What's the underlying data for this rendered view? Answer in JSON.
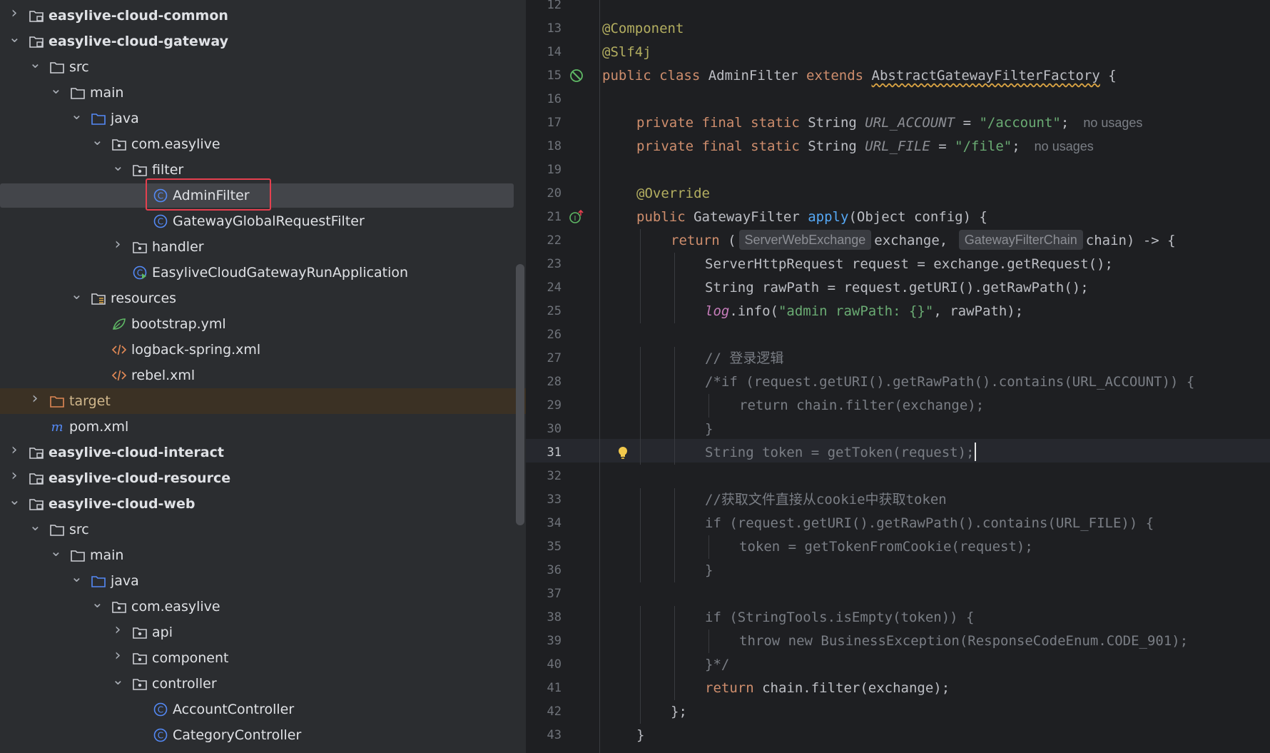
{
  "tree": {
    "rows": [
      {
        "label": "easylive-cloud-common",
        "bold": true,
        "chevron": "right",
        "icon": "module-folder-icon",
        "depth": 0
      },
      {
        "label": "easylive-cloud-gateway",
        "bold": true,
        "chevron": "down",
        "icon": "module-folder-icon",
        "depth": 0
      },
      {
        "label": "src",
        "chevron": "down",
        "icon": "folder-icon",
        "depth": 1
      },
      {
        "label": "main",
        "chevron": "down",
        "icon": "folder-icon",
        "depth": 2
      },
      {
        "label": "java",
        "chevron": "down",
        "icon": "source-folder-icon",
        "depth": 3
      },
      {
        "label": "com.easylive",
        "chevron": "down",
        "icon": "package-icon",
        "depth": 4
      },
      {
        "label": "filter",
        "chevron": "down",
        "icon": "package-icon",
        "depth": 5
      },
      {
        "label": "AdminFilter",
        "chevron": "",
        "icon": "class-icon",
        "depth": 6,
        "selected": true
      },
      {
        "label": "GatewayGlobalRequestFilter",
        "chevron": "",
        "icon": "class-icon",
        "depth": 6
      },
      {
        "label": "handler",
        "chevron": "right",
        "icon": "package-icon",
        "depth": 5
      },
      {
        "label": "EasyliveCloudGatewayRunApplication",
        "chevron": "",
        "icon": "spring-app-icon",
        "depth": 5
      },
      {
        "label": "resources",
        "chevron": "down",
        "icon": "resources-folder-icon",
        "depth": 3
      },
      {
        "label": "bootstrap.yml",
        "chevron": "",
        "icon": "yaml-icon",
        "depth": 4
      },
      {
        "label": "logback-spring.xml",
        "chevron": "",
        "icon": "xml-icon",
        "depth": 4
      },
      {
        "label": "rebel.xml",
        "chevron": "",
        "icon": "xml-icon",
        "depth": 4
      },
      {
        "label": "target",
        "chevron": "right",
        "icon": "excluded-folder-icon",
        "depth": 1,
        "excluded": true
      },
      {
        "label": "pom.xml",
        "chevron": "",
        "icon": "maven-icon",
        "depth": 1
      },
      {
        "label": "easylive-cloud-interact",
        "bold": true,
        "chevron": "right",
        "icon": "module-folder-icon",
        "depth": 0
      },
      {
        "label": "easylive-cloud-resource",
        "bold": true,
        "chevron": "right",
        "icon": "module-folder-icon",
        "depth": 0
      },
      {
        "label": "easylive-cloud-web",
        "bold": true,
        "chevron": "down",
        "icon": "module-folder-icon",
        "depth": 0
      },
      {
        "label": "src",
        "chevron": "down",
        "icon": "folder-icon",
        "depth": 1
      },
      {
        "label": "main",
        "chevron": "down",
        "icon": "folder-icon",
        "depth": 2
      },
      {
        "label": "java",
        "chevron": "down",
        "icon": "source-folder-icon",
        "depth": 3
      },
      {
        "label": "com.easylive",
        "chevron": "down",
        "icon": "package-icon",
        "depth": 4
      },
      {
        "label": "api",
        "chevron": "right",
        "icon": "package-icon",
        "depth": 5
      },
      {
        "label": "component",
        "chevron": "right",
        "icon": "package-icon",
        "depth": 5
      },
      {
        "label": "controller",
        "chevron": "down",
        "icon": "package-icon",
        "depth": 5
      },
      {
        "label": "AccountController",
        "chevron": "",
        "icon": "class-icon",
        "depth": 6
      },
      {
        "label": "CategoryController",
        "chevron": "",
        "icon": "class-icon",
        "depth": 6
      }
    ]
  },
  "editor": {
    "current_line": 31,
    "lines": [
      {
        "n": 12,
        "indent": 0,
        "parts": []
      },
      {
        "n": 13,
        "indent": 0,
        "parts": [
          {
            "t": "@Component",
            "c": "an"
          }
        ]
      },
      {
        "n": 14,
        "indent": 0,
        "parts": [
          {
            "t": "@Slf4j",
            "c": "an"
          }
        ]
      },
      {
        "n": 15,
        "indent": 0,
        "icon": "no-bean-icon",
        "parts": [
          {
            "t": "public class ",
            "c": "k"
          },
          {
            "t": "AdminFilter ",
            "c": "pl"
          },
          {
            "t": "extends ",
            "c": "k"
          },
          {
            "t": "AbstractGatewayFilterFactory",
            "c": "pl ul"
          },
          {
            "t": " {",
            "c": "pl"
          }
        ]
      },
      {
        "n": 16,
        "indent": 0,
        "parts": []
      },
      {
        "n": 17,
        "indent": 1,
        "parts": [
          {
            "t": "private final static ",
            "c": "k"
          },
          {
            "t": "String ",
            "c": "pl"
          },
          {
            "t": "URL_ACCOUNT",
            "c": "dc it"
          },
          {
            "t": " = ",
            "c": "pl"
          },
          {
            "t": "\"/account\"",
            "c": "s"
          },
          {
            "t": ";",
            "c": "pl"
          },
          {
            "t": "no usages",
            "c": "usage"
          }
        ]
      },
      {
        "n": 18,
        "indent": 1,
        "parts": [
          {
            "t": "private final static ",
            "c": "k"
          },
          {
            "t": "String ",
            "c": "pl"
          },
          {
            "t": "URL_FILE",
            "c": "dc it"
          },
          {
            "t": " = ",
            "c": "pl"
          },
          {
            "t": "\"/file\"",
            "c": "s"
          },
          {
            "t": ";",
            "c": "pl"
          },
          {
            "t": "no usages",
            "c": "usage"
          }
        ]
      },
      {
        "n": 19,
        "indent": 0,
        "parts": []
      },
      {
        "n": 20,
        "indent": 1,
        "parts": [
          {
            "t": "@Override",
            "c": "an"
          }
        ]
      },
      {
        "n": 21,
        "indent": 1,
        "icon": "override-icon",
        "parts": [
          {
            "t": "public ",
            "c": "k"
          },
          {
            "t": "GatewayFilter ",
            "c": "pl"
          },
          {
            "t": "apply",
            "c": "fn"
          },
          {
            "t": "(Object config) {",
            "c": "pl"
          }
        ]
      },
      {
        "n": 22,
        "indent": 2,
        "parts": [
          {
            "t": "return ",
            "c": "k"
          },
          {
            "t": "(",
            "c": "pl"
          },
          {
            "t": "ServerWebExchange",
            "c": "hint"
          },
          {
            "t": "exchange, ",
            "c": "pl"
          },
          {
            "t": "GatewayFilterChain",
            "c": "hint"
          },
          {
            "t": "chain) -> {",
            "c": "pl"
          }
        ]
      },
      {
        "n": 23,
        "indent": 3,
        "parts": [
          {
            "t": "ServerHttpRequest request = exchange.getRequest();",
            "c": "pl"
          }
        ]
      },
      {
        "n": 24,
        "indent": 3,
        "parts": [
          {
            "t": "String rawPath = request.getURI().getRawPath();",
            "c": "pl"
          }
        ]
      },
      {
        "n": 25,
        "indent": 3,
        "parts": [
          {
            "t": "log",
            "c": "lg"
          },
          {
            "t": ".info(",
            "c": "pl"
          },
          {
            "t": "\"admin rawPath: {}\"",
            "c": "s"
          },
          {
            "t": ", rawPath);",
            "c": "pl"
          }
        ]
      },
      {
        "n": 26,
        "indent": 0,
        "parts": []
      },
      {
        "n": 27,
        "indent": 3,
        "parts": [
          {
            "t": "// 登录逻辑",
            "c": "cm"
          }
        ]
      },
      {
        "n": 28,
        "indent": 3,
        "parts": [
          {
            "t": "/*if (request.getURI().getRawPath().contains(URL_ACCOUNT)) {",
            "c": "cm"
          }
        ]
      },
      {
        "n": 29,
        "indent": 4,
        "parts": [
          {
            "t": "return chain.filter(exchange);",
            "c": "cm"
          }
        ]
      },
      {
        "n": 30,
        "indent": 3,
        "parts": [
          {
            "t": "}",
            "c": "cm"
          }
        ]
      },
      {
        "n": 31,
        "indent": 3,
        "icon": "bulb-icon",
        "caret": true,
        "parts": [
          {
            "t": "String token = getToken(request);",
            "c": "cm"
          }
        ]
      },
      {
        "n": 32,
        "indent": 0,
        "parts": []
      },
      {
        "n": 33,
        "indent": 3,
        "parts": [
          {
            "t": "//获取文件直接从cookie中获取token",
            "c": "cm"
          }
        ]
      },
      {
        "n": 34,
        "indent": 3,
        "parts": [
          {
            "t": "if (request.getURI().getRawPath().contains(URL_FILE)) {",
            "c": "cm"
          }
        ]
      },
      {
        "n": 35,
        "indent": 4,
        "parts": [
          {
            "t": "token = getTokenFromCookie(request);",
            "c": "cm"
          }
        ]
      },
      {
        "n": 36,
        "indent": 3,
        "parts": [
          {
            "t": "}",
            "c": "cm"
          }
        ]
      },
      {
        "n": 37,
        "indent": 0,
        "parts": []
      },
      {
        "n": 38,
        "indent": 3,
        "parts": [
          {
            "t": "if (StringTools.isEmpty(token)) {",
            "c": "cm"
          }
        ]
      },
      {
        "n": 39,
        "indent": 4,
        "parts": [
          {
            "t": "throw new BusinessException(ResponseCodeEnum.CODE_901);",
            "c": "cm"
          }
        ]
      },
      {
        "n": 40,
        "indent": 3,
        "parts": [
          {
            "t": "}*/",
            "c": "cm"
          }
        ]
      },
      {
        "n": 41,
        "indent": 3,
        "parts": [
          {
            "t": "return ",
            "c": "k"
          },
          {
            "t": "chain.filter(exchange);",
            "c": "pl"
          }
        ]
      },
      {
        "n": 42,
        "indent": 2,
        "parts": [
          {
            "t": "};",
            "c": "pl"
          }
        ]
      },
      {
        "n": 43,
        "indent": 1,
        "parts": [
          {
            "t": "}",
            "c": "pl"
          }
        ]
      }
    ]
  },
  "colors": {
    "tree_bg": "#2b2d30",
    "editor_bg": "#1e1f22",
    "keyword": "#cf8e6d",
    "annotation": "#b3ae60",
    "string": "#6aab73",
    "comment": "#7a7e85",
    "function": "#56a8f5",
    "highlight_box": "#e5404f"
  }
}
